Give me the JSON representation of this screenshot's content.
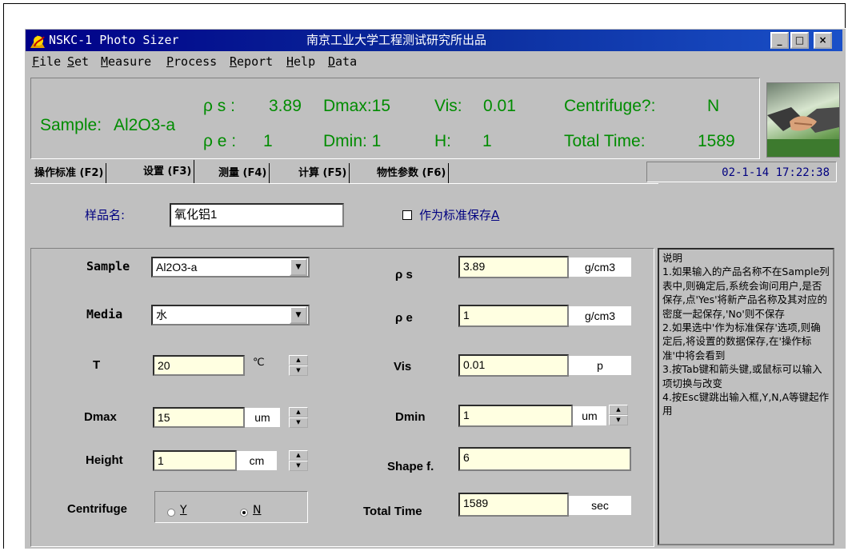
{
  "window": {
    "app_title": "NSKC-1 Photo Sizer",
    "subtitle": "南京工业大学工程测试研究所出品",
    "controls": {
      "minimize": "_",
      "maximize": "□",
      "close": "×"
    }
  },
  "menu": [
    {
      "key": "F",
      "rest": "ile"
    },
    {
      "key": "S",
      "rest": "et"
    },
    {
      "key": "M",
      "rest": "easure"
    },
    {
      "key": "P",
      "rest": "rocess"
    },
    {
      "key": "R",
      "rest": "eport"
    },
    {
      "key": "H",
      "rest": "elp"
    },
    {
      "key": "D",
      "rest": "ata"
    }
  ],
  "info": {
    "sample_label": "Sample:",
    "sample_value": "Al2O3-a",
    "rho_s_label": "ρ s :",
    "rho_s_value": "3.89",
    "rho_e_label": "ρ e :",
    "rho_e_value": "1",
    "dmax": "Dmax:15",
    "dmin": "Dmin: 1",
    "vis_label": "Vis:",
    "vis_value": "0.01",
    "h_label": "H:",
    "h_value": "1",
    "centrifuge_label": "Centrifuge?:",
    "centrifuge_value": "N",
    "total_time_label": "Total Time:",
    "total_time_value": "1589"
  },
  "tabs": [
    {
      "label": "操作标准 (F2)",
      "active": false
    },
    {
      "label": "设置 (F3)",
      "active": true
    },
    {
      "label": "测量 (F4)",
      "active": false
    },
    {
      "label": "计算 (F5)",
      "active": false
    },
    {
      "label": "物性参数 (F6)",
      "active": false
    }
  ],
  "datetime": "02-1-14 17:22:38",
  "form": {
    "sample_name_label": "样品名:",
    "sample_name_value": "氧化铝1",
    "save_as_standard_label": "作为标准保存",
    "save_as_standard_key": "A",
    "sample_label": "Sample",
    "sample_value": "Al2O3-a",
    "media_label": "Media",
    "media_value": "水",
    "t_label": "T",
    "t_value": "20",
    "t_unit": "℃",
    "dmax_label": "Dmax",
    "dmax_value": "15",
    "dmax_unit": "um",
    "height_label": "Height",
    "height_value": "1",
    "height_unit": "cm",
    "centrifuge_label": "Centrifuge",
    "radio_y": "Y",
    "radio_n": "N",
    "centrifuge_selected": "N",
    "rho_s_label": "ρ s",
    "rho_s_value": "3.89",
    "rho_s_unit": "g/cm3",
    "rho_e_label": "ρ e",
    "rho_e_value": "1",
    "rho_e_unit": "g/cm3",
    "vis_label": "Vis",
    "vis_value": "0.01",
    "vis_unit": "p",
    "dmin_label": "Dmin",
    "dmin_value": "1",
    "dmin_unit": "um",
    "shape_label": "Shape f.",
    "shape_value": "6",
    "total_time_label": "Total Time",
    "total_time_value": "1589",
    "total_time_unit": "sec"
  },
  "notes": "说明\n1.如果输入的产品名称不在Sample列表中,则确定后,系统会询问用户,是否保存,点'Yes'将新产品名称及其对应的密度一起保存,'No'则不保存\n2.如果选中'作为标准保存'选项,则确定后,将设置的数据保存,在'操作标准'中将会看到\n3.按Tab键和箭头键,或鼠标可以输入项切换与改变\n4.按Esc键跳出输入框,Y,N,A等键起作用",
  "colors": {
    "title_start": "#000088",
    "title_end": "#1a50c8",
    "info_text": "#008c00",
    "field_bg": "#ffffe1",
    "face": "#c0c0c0"
  }
}
